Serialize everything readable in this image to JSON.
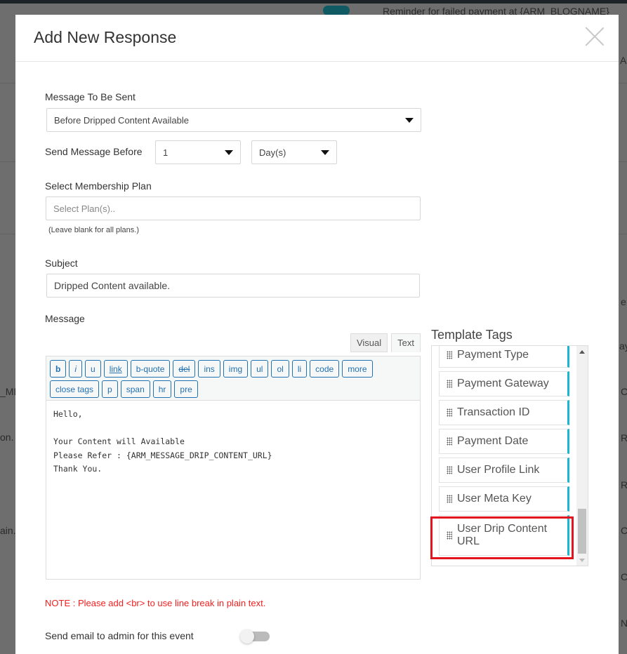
{
  "background": {
    "reminder_text": "Reminder for failed payment at {ARM_BLOGNAME}",
    "left_fragments": [
      "_ME",
      "on.",
      "ain."
    ],
    "right_fragments": [
      "AM",
      "e",
      "ay",
      "C",
      "R",
      "R",
      "C",
      "C",
      "N"
    ]
  },
  "modal": {
    "title": "Add New Response",
    "close_label": "×"
  },
  "form": {
    "message_label": "Message To Be Sent",
    "message_value": "Before Dripped Content Available",
    "send_before_label": "Send Message Before",
    "send_before_value": "1",
    "send_before_unit": "Day(s)",
    "plan_label": "Select Membership Plan",
    "plan_placeholder": "Select Plan(s)..",
    "plan_hint": "(Leave blank for all plans.)",
    "subject_label": "Subject",
    "subject_value": "Dripped Content available.",
    "message_body_label": "Message",
    "note": "NOTE : Please add <br> to use line break in plain text.",
    "admin_email_label": "Send email to admin for this event",
    "admin_email_enabled": false
  },
  "editor": {
    "tabs": [
      "Visual",
      "Text"
    ],
    "active_tab": "Text",
    "buttons": [
      "b",
      "i",
      "u",
      "link",
      "b-quote",
      "del",
      "ins",
      "img",
      "ul",
      "ol",
      "li",
      "code",
      "more",
      "close tags",
      "p",
      "span",
      "hr",
      "pre"
    ],
    "content": "Hello,\n\nYour Content will Available\nPlease Refer : {ARM_MESSAGE_DRIP_CONTENT_URL}\nThank You."
  },
  "template_tags": {
    "title": "Template Tags",
    "items": [
      "Payment Type",
      "Payment Gateway",
      "Transaction ID",
      "Payment Date",
      "User Profile Link",
      "User Meta Key",
      "User Drip Content URL"
    ],
    "highlighted": "User Drip Content URL"
  }
}
